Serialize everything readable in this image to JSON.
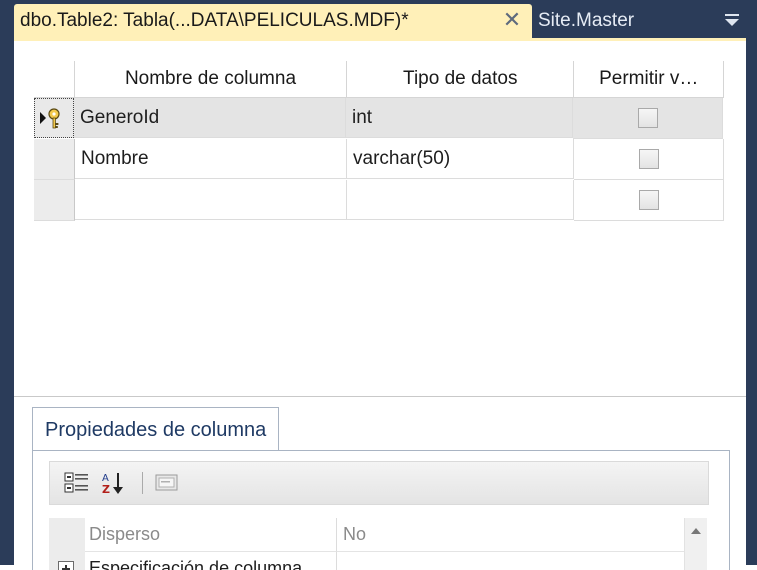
{
  "tabs": [
    {
      "label": "dbo.Table2: Tabla(...DATA\\PELICULAS.MDF)*",
      "active": true
    },
    {
      "label": "Site.Master",
      "active": false
    }
  ],
  "icons": {
    "tab_close": "close-icon",
    "tab_menu": "dropdown-menu-icon",
    "primary_key": "primary-key-icon",
    "current_row": "row-pointer-icon",
    "categorized": "categorized-view-icon",
    "alphabetical": "sort-alphabetical-icon",
    "property_pages": "property-pages-icon",
    "expander": "expand-plus-icon",
    "scroll_up": "scroll-up-icon"
  },
  "grid": {
    "headers": [
      "Nombre de columna",
      "Tipo de datos",
      "Permitir v…"
    ],
    "rows": [
      {
        "name": "GeneroId",
        "type": "int",
        "allow_nulls": false
      },
      {
        "name": "Nombre",
        "type": "varchar(50)",
        "allow_nulls": false
      },
      {
        "name": "",
        "type": "",
        "allow_nulls": false
      }
    ]
  },
  "properties": {
    "tab_label": "Propiedades de columna",
    "rows": [
      {
        "name": "Disperso",
        "value": "No"
      },
      {
        "name": "Especificación de columna",
        "value": ""
      }
    ]
  },
  "colors": {
    "active_tab": "#fff0b8",
    "frame": "#2b3c59",
    "properties_tab_text": "#1f3a64"
  }
}
